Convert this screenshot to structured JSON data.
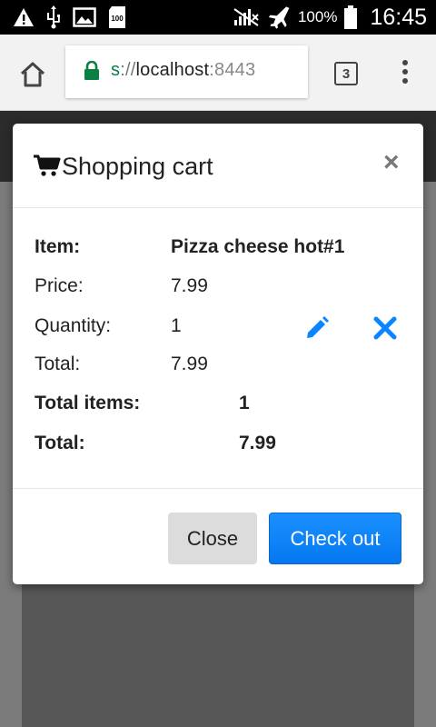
{
  "status_bar": {
    "icons_left": [
      "warning-icon",
      "usb-icon",
      "image-icon",
      "storage-100-icon"
    ],
    "icons_right": [
      "no-signal-icon",
      "airplane-icon",
      "battery-icon"
    ],
    "battery": "100%",
    "time": "16:45"
  },
  "browser": {
    "url_scheme": "s",
    "url_sep": "://",
    "url_host": "localhost",
    "url_port": ":8443",
    "tab_count": "3"
  },
  "modal": {
    "title": "Shopping cart",
    "close_glyph": "×",
    "item_label": "Item:",
    "item_value": "Pizza cheese hot#1",
    "price_label": "Price:",
    "price_value": "7.99",
    "quantity_label": "Quantity:",
    "quantity_value": "1",
    "line_total_label": "Total:",
    "line_total_value": "7.99",
    "total_items_label": "Total items:",
    "total_items_value": "1",
    "grand_total_label": "Total:",
    "grand_total_value": "7.99",
    "close_button": "Close",
    "checkout_button": "Check out"
  },
  "colors": {
    "accent": "#0a84ff",
    "secure_green": "#0b8043",
    "close_gray": "#dcdcdc"
  }
}
